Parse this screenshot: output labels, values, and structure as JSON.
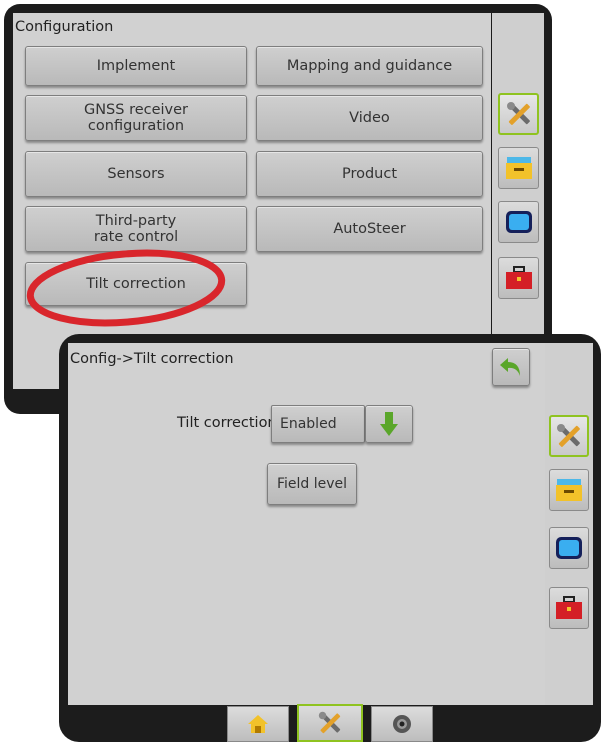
{
  "back": {
    "title": "Configuration",
    "buttons": [
      {
        "label": "Implement"
      },
      {
        "label": "Mapping and guidance"
      },
      {
        "label": "GNSS receiver configuration"
      },
      {
        "label": "Video"
      },
      {
        "label": "Sensors"
      },
      {
        "label": "Product"
      },
      {
        "label": "Third-party rate control"
      },
      {
        "label": "AutoSteer"
      },
      {
        "label": "Tilt correction"
      }
    ]
  },
  "front": {
    "title": "Config->Tilt correction",
    "tilt_label": "Tilt correction",
    "tilt_value": "Enabled",
    "field_level_label": "Field level"
  },
  "side_tabs": [
    "tools-icon",
    "console-icon",
    "monitor-icon",
    "toolbox-icon"
  ],
  "bottom_tabs": [
    "home-icon",
    "tools-icon",
    "camera-icon"
  ],
  "colors": {
    "highlight_ring": "#d9262c",
    "selected_border": "#8fc320",
    "accent_green": "#5aa62a"
  }
}
